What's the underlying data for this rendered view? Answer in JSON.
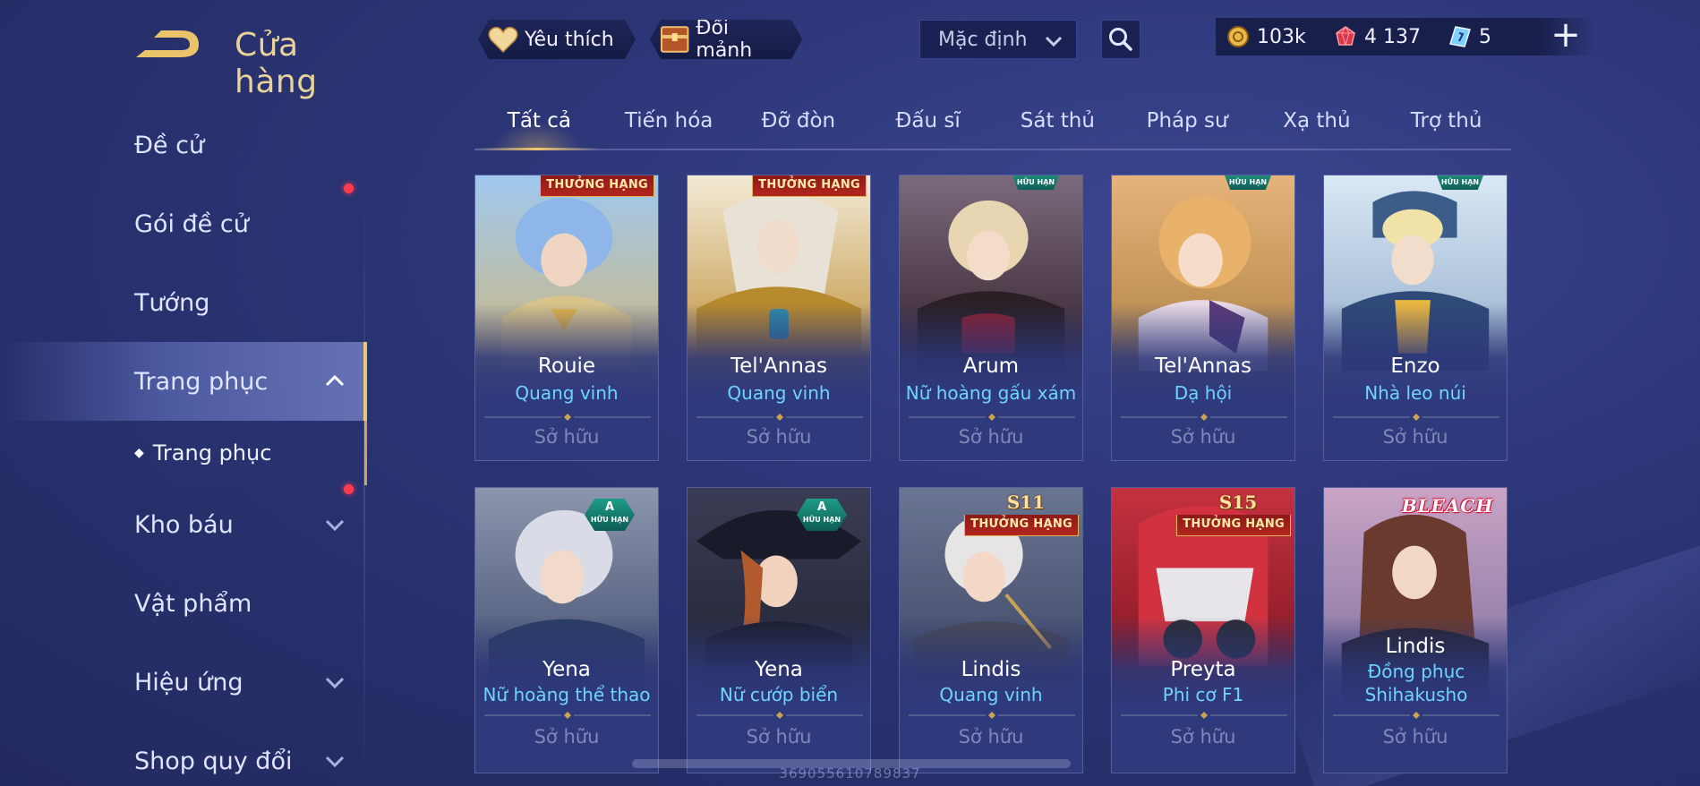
{
  "header": {
    "title": "Cửa hàng",
    "favorites_label": "Yêu thích",
    "exchange_label": "Đổi mảnh",
    "sort": {
      "selected": "Mặc định"
    },
    "currency": {
      "gold": "103k",
      "ruby": "4 137",
      "voucher": "5"
    },
    "add_label": "+"
  },
  "sidebar": {
    "items": [
      {
        "label": "Đề cử"
      },
      {
        "label": "Gói đề cử"
      },
      {
        "label": "Tướng"
      },
      {
        "label": "Trang phục"
      },
      {
        "label": "Kho báu"
      },
      {
        "label": "Vật phẩm"
      },
      {
        "label": "Hiệu ứng"
      },
      {
        "label": "Shop quy đổi"
      }
    ],
    "sub_item": {
      "label": "Trang phục"
    }
  },
  "tabs": [
    "Tất cả",
    "Tiến hóa",
    "Đỡ đòn",
    "Đấu sĩ",
    "Sát thủ",
    "Pháp sư",
    "Xạ thủ",
    "Trợ thủ"
  ],
  "badges": {
    "rank": "THƯỞNG HẠNG",
    "limited": "HỮU HẠN",
    "grade_a": "A",
    "season_11": "S11",
    "season_15": "S15",
    "bleach": "BLEACH"
  },
  "cards": [
    {
      "hero": "Rouie",
      "skin": "Quang vinh",
      "status": "Sở hữu",
      "badge": "rank"
    },
    {
      "hero": "Tel'Annas",
      "skin": "Quang vinh",
      "status": "Sở hữu",
      "badge": "rank"
    },
    {
      "hero": "Arum",
      "skin": "Nữ hoàng gấu xám",
      "status": "Sở hữu",
      "badge": "limited"
    },
    {
      "hero": "Tel'Annas",
      "skin": "Dạ hội",
      "status": "Sở hữu",
      "badge": "limited"
    },
    {
      "hero": "Enzo",
      "skin": "Nhà leo núi",
      "status": "Sở hữu",
      "badge": "limited"
    },
    {
      "hero": "Yena",
      "skin": "Nữ hoàng thể thao",
      "status": "Sở hữu",
      "badge": "grade_a"
    },
    {
      "hero": "Yena",
      "skin": "Nữ cướp biển",
      "status": "Sở hữu",
      "badge": "grade_a"
    },
    {
      "hero": "Lindis",
      "skin": "Quang vinh",
      "status": "Sở hữu",
      "badge": "season_11"
    },
    {
      "hero": "Preyta",
      "skin": "Phi cơ F1",
      "status": "Sở hữu",
      "badge": "season_15"
    },
    {
      "hero": "Lindis",
      "skin": "Đồng phục Shihakusho",
      "status": "Sở hữu",
      "badge": "bleach"
    }
  ],
  "footer": {
    "user_id": "369055610789837"
  },
  "colors": {
    "accent_gold": "#e9c46a",
    "skin_blue": "#6fd3ff",
    "notify_red": "#ff3b4f"
  }
}
